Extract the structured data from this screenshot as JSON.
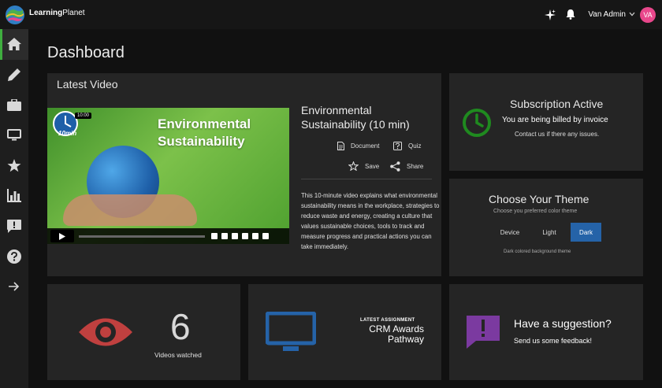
{
  "header": {
    "brand_bold": "Learning",
    "brand_rest": "Planet",
    "user_name": "Van Admin",
    "avatar_initials": "VA",
    "icons": [
      "sparkle-icon",
      "bell-icon",
      "chevron-down-icon"
    ]
  },
  "sidebar": {
    "items": [
      {
        "icon": "home-icon",
        "active": true
      },
      {
        "icon": "pencil-icon",
        "active": false
      },
      {
        "icon": "briefcase-icon",
        "active": false
      },
      {
        "icon": "monitor-icon",
        "active": false
      },
      {
        "icon": "star-icon",
        "active": false
      },
      {
        "icon": "bar-chart-icon",
        "active": false
      },
      {
        "icon": "feedback-icon",
        "active": false
      },
      {
        "icon": "help-icon",
        "active": false
      },
      {
        "icon": "arrow-right-icon",
        "active": false
      }
    ]
  },
  "page": {
    "title": "Dashboard"
  },
  "latest_video": {
    "card_title": "Latest Video",
    "thumbnail_title_line1": "Environmental",
    "thumbnail_title_line2": "Sustainability",
    "badge": "10min",
    "time_tooltip": "10:00",
    "heading": "Environmental Sustainability (10 min)",
    "document_label": "Document",
    "quiz_label": "Quiz",
    "save_label": "Save",
    "share_label": "Share",
    "description": "This 10-minute video explains what environmental sustainability means in the workplace, strategies to reduce waste and energy, creating a culture that values sustainable choices, tools to track and measure progress and practical actions you can take immediately."
  },
  "subscription": {
    "title": "Subscription Active",
    "line1": "You are being billed by invoice",
    "line2": "Contact us if there any issues.",
    "accent_color": "#1f8a1f"
  },
  "theme": {
    "title": "Choose Your Theme",
    "subtitle": "Choose you preferred color theme",
    "options": [
      "Device",
      "Light",
      "Dark"
    ],
    "selected": "Dark",
    "note": "Dark colored background theme",
    "selected_color": "#2563a8"
  },
  "stats": {
    "videos_watched_value": "6",
    "videos_watched_label": "Videos watched",
    "eye_color": "#c0403f"
  },
  "assignment": {
    "label": "LATEST ASSIGNMENT",
    "name": "CRM Awards Pathway",
    "monitor_color": "#2563a8"
  },
  "suggestion": {
    "title": "Have a suggestion?",
    "subtitle": "Send us some feedback!",
    "icon_color": "#7b3aa0"
  }
}
